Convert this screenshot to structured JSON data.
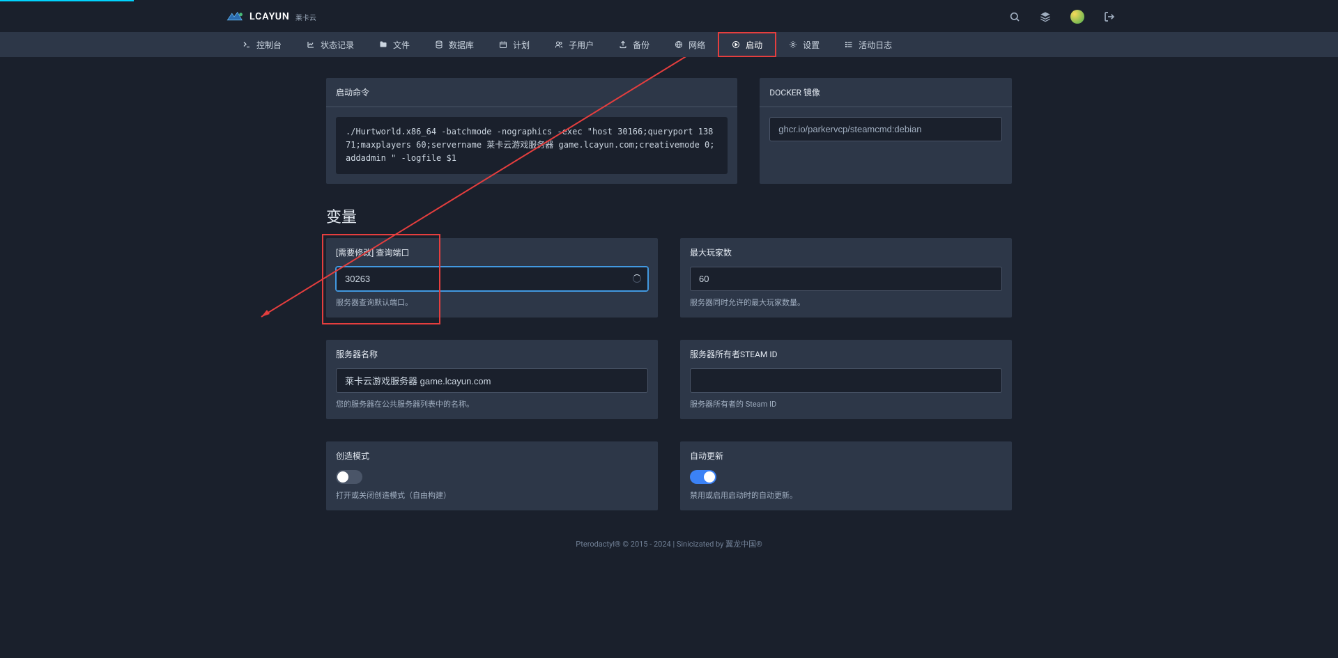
{
  "brand": {
    "name": "LCAYUN",
    "sub": "莱卡云"
  },
  "nav": {
    "items": [
      {
        "label": "控制台",
        "icon": "terminal"
      },
      {
        "label": "状态记录",
        "icon": "chart"
      },
      {
        "label": "文件",
        "icon": "folder"
      },
      {
        "label": "数据库",
        "icon": "database"
      },
      {
        "label": "计划",
        "icon": "calendar"
      },
      {
        "label": "子用户",
        "icon": "users"
      },
      {
        "label": "备份",
        "icon": "upload"
      },
      {
        "label": "网络",
        "icon": "network"
      },
      {
        "label": "启动",
        "icon": "play",
        "active": true
      },
      {
        "label": "设置",
        "icon": "cog"
      },
      {
        "label": "活动日志",
        "icon": "list"
      }
    ]
  },
  "startup": {
    "title": "启动命令",
    "command": "./Hurtworld.x86_64 -batchmode -nographics -exec \"host 30166;queryport 13871;maxplayers 60;servername 莱卡云游戏服务器 game.lcayun.com;creativemode 0;addadmin \" -logfile $1"
  },
  "docker": {
    "title": "DOCKER 镜像",
    "image": "ghcr.io/parkervcp/steamcmd:debian"
  },
  "variables": {
    "title": "变量",
    "items": [
      {
        "label": "[需要修改] 查询端口",
        "value": "30263",
        "hint": "服务器查询默认端口。",
        "focused": true,
        "loading": true
      },
      {
        "label": "最大玩家数",
        "value": "60",
        "hint": "服务器同时允许的最大玩家数量。"
      },
      {
        "label": "服务器名称",
        "value": "莱卡云游戏服务器 game.lcayun.com",
        "hint": "您的服务器在公共服务器列表中的名称。"
      },
      {
        "label": "服务器所有者STEAM ID",
        "value": "",
        "hint": "服务器所有者的 Steam ID"
      },
      {
        "label": "创造模式",
        "toggle": false,
        "hint": "打开或关闭创造模式（自由构建）"
      },
      {
        "label": "自动更新",
        "toggle": true,
        "hint": "禁用或启用启动时的自动更新。"
      }
    ]
  },
  "footer": "Pterodactyl® © 2015 - 2024 | Sinicizated by 翼龙中国®"
}
